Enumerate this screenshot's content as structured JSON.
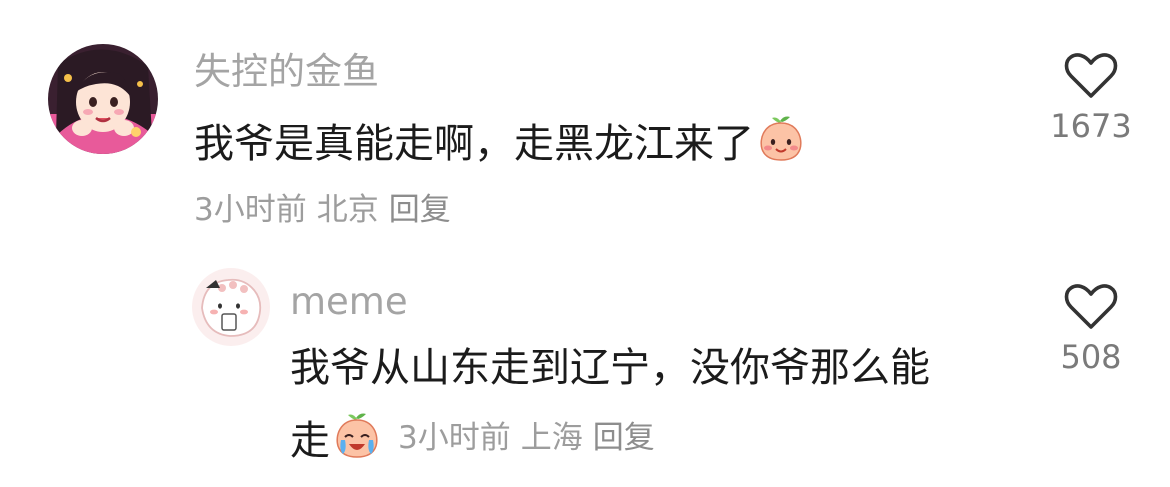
{
  "comment": {
    "username": "失控的金鱼",
    "text": "我爷是真能走啊，走黑龙江来了",
    "emoji_icon": "peach-smile-emoji",
    "time": "3小时前",
    "location": "北京",
    "reply_label": "回复",
    "like_icon": "heart-outline-icon",
    "like_count": "1673"
  },
  "reply": {
    "username": "meme",
    "text_line1": "我爷从山东走到辽宁，没你爷那么能",
    "text_line2": "走",
    "emoji_icon": "peach-crying-laughing-emoji",
    "time": "3小时前",
    "location": "上海",
    "reply_label": "回复",
    "like_icon": "heart-outline-icon",
    "like_count": "508"
  },
  "colors": {
    "username": "#a4a4a4",
    "text": "#1b1b1b",
    "meta": "#9d9d9d",
    "like_count": "#7a7a7a",
    "heart_stroke": "#333333"
  }
}
